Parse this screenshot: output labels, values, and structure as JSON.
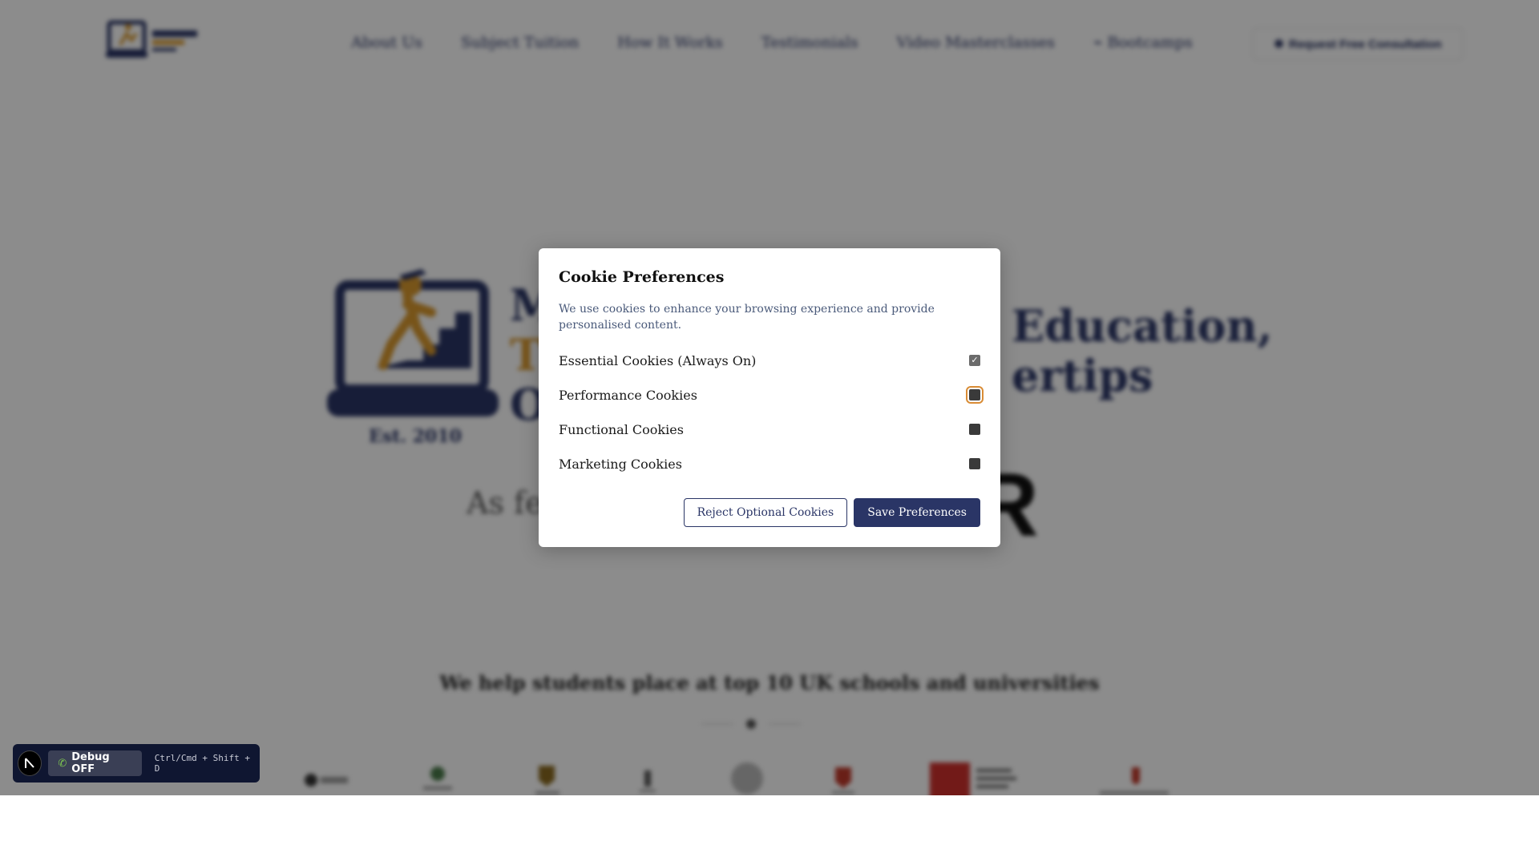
{
  "header": {
    "nav": [
      "About Us",
      "Subject Tuition",
      "How It Works",
      "Testimonials",
      "Video Masterclasses",
      "Bootcamps"
    ],
    "cta_label": "Request Free Consultation"
  },
  "hero": {
    "title_line1": "M",
    "title_line2": "T",
    "title_line3": "O",
    "title_right_line1": "Education,",
    "title_right_line2": "ertips",
    "est": "Est. 2010",
    "featured_prefix": "As fea",
    "featured_logo_letter": "R"
  },
  "tagline": "We help students place at top 10 UK schools and universities",
  "cookie_modal": {
    "title": "Cookie Preferences",
    "description": "We use cookies to enhance your browsing experience and provide personalised content.",
    "options": [
      {
        "label": "Essential Cookies (Always On)",
        "checked": true,
        "disabled": true
      },
      {
        "label": "Performance Cookies",
        "checked": true,
        "focused": true
      },
      {
        "label": "Functional Cookies",
        "checked": true
      },
      {
        "label": "Marketing Cookies",
        "checked": true
      }
    ],
    "reject_label": "Reject Optional Cookies",
    "save_label": "Save Preferences"
  },
  "debug": {
    "button_label": "Debug OFF",
    "shortcut": "Ctrl/Cmd + Shift + D"
  },
  "colors": {
    "navy": "#2a3566",
    "gold": "#d9992e",
    "focus_ring": "#d98c35"
  }
}
